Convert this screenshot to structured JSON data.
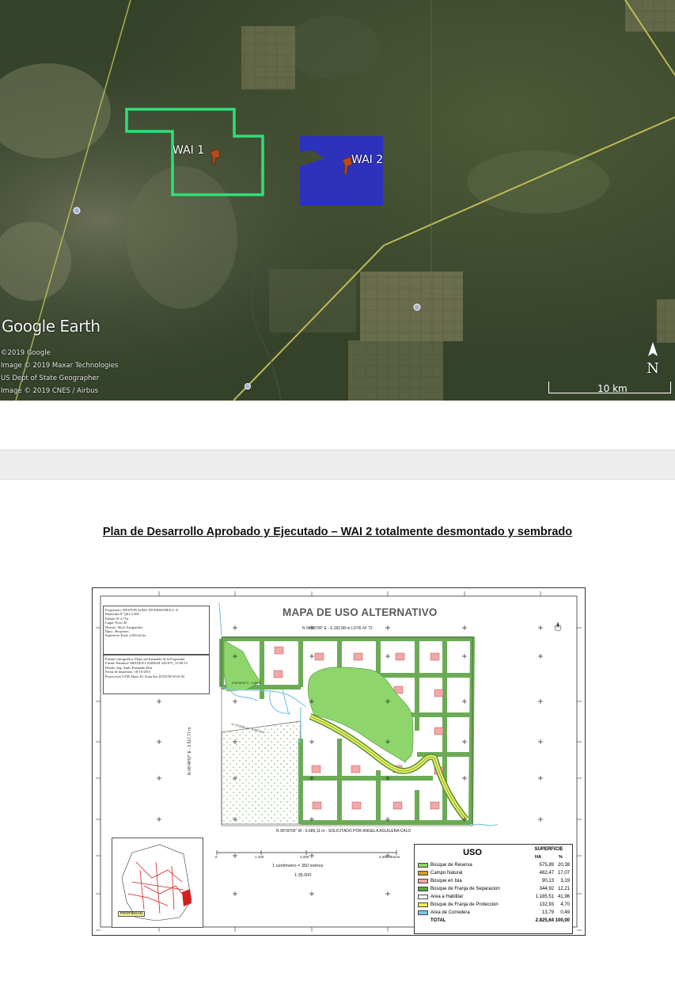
{
  "satellite": {
    "logo": "Google Earth",
    "credits": [
      "©2019 Google",
      "Image © 2019 Maxar Technologies",
      "US Dept of State Geographer",
      "Image © 2019 CNES / Airbus"
    ],
    "labels": {
      "wai1": "WAI 1",
      "wai2": "WAI 2"
    },
    "north": "N",
    "scale": "10 km",
    "colors": {
      "wai1_outline": "#2ee07a",
      "wai2_fill": "#2b2fc8",
      "road": "#c9c65a"
    }
  },
  "document": {
    "title": "Plan de Desarrollo Aprobado y Ejecutado – WAI 2 totalmente desmontado y sembrado"
  },
  "map": {
    "title": "MAPA DE USO ALTERNATIVO",
    "info_box_1": [
      "Propietario: WESTON AGRO INVERSIONES S. A.",
      "Matrícula Nº Q01-2.200",
      "Padrón Nº 4.754",
      "Lugar: Pozo 40",
      "Distrito: Mcal. Estigarribia",
      "Dpto.: Boqueron",
      "Superficie Total: 2.825,64 ha"
    ],
    "info_box_2": [
      "Fuente Cartográfica: Plano del Inmueble de la Propiedad",
      "Fuente Temática: IMAGEN LANDSAT 228-075_13-06-15",
      "Diseño: Ing. Amb. Fernando Díaz",
      "Fecha de impresión: 18-10-2015",
      "Proyección UTM, Huso 20, Zona Sur, DATUM WGS 84"
    ],
    "boundary_labels": {
      "north": "N 90º00'00\" E - 6.182,88 m LOTE Nº 72",
      "south": "N 90º00'00\" W - 6.689,11 m - SOLICITADO POR ANGELA AGUILERA CALO",
      "west": "N 00º48'57\" E - 2.517,77 m",
      "diag1": "S 82º53'00\" E - 1.055 m",
      "diag2": "N 72º19'58\" W - 1.995,42 m"
    },
    "legend": {
      "title": "USO",
      "superficie": "SUPERFICIE",
      "col_ha": "HA",
      "col_pct": "%",
      "rows": [
        {
          "label": "Bosque de Reserva",
          "ha": "575,89",
          "pct": "20,38",
          "color": "#8ed66b"
        },
        {
          "label": "Campo Natural",
          "ha": "482,47",
          "pct": "17,07",
          "color": "#c9a227"
        },
        {
          "label": "Bosque en Isla",
          "ha": "90,13",
          "pct": "3,19",
          "color": "#f3a7a7"
        },
        {
          "label": "Bosque de Franja de Separacion",
          "ha": "344,92",
          "pct": "12,21",
          "color": "#5aa74a"
        },
        {
          "label": "Area a Habilitar",
          "ha": "1.185,51",
          "pct": "41,96",
          "color": "#ffffff"
        },
        {
          "label": "Bosque de Franja de Proteccion",
          "ha": "132,93",
          "pct": "4,70",
          "color": "#f3ec5a"
        },
        {
          "label": "Area de Corredera",
          "ha": "13,79",
          "pct": "0,49",
          "color": "#7ec8e3"
        }
      ],
      "total": {
        "label": "TOTAL",
        "ha": "2.825,64",
        "pct": "100,00"
      }
    },
    "scalebar": {
      "ticks": [
        "0",
        "1.100",
        "2.200",
        "4.400 Metros"
      ],
      "text": "1 centímetro = 350 metros",
      "ratio": "1:35.000"
    },
    "inset_label": "PROPIEDAD"
  }
}
